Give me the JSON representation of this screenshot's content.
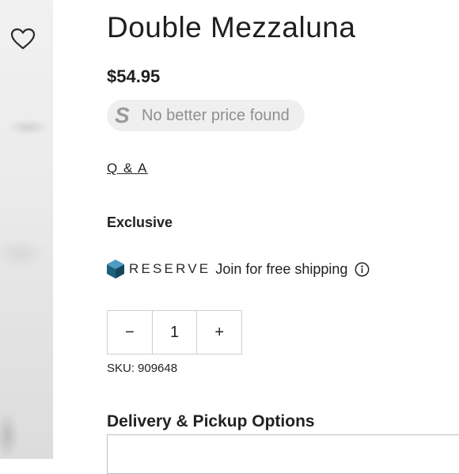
{
  "product": {
    "title": "Double Mezzaluna",
    "price": "$54.95"
  },
  "price_check": {
    "icon": "S",
    "text": "No better price found"
  },
  "links": {
    "qa": "Q & A"
  },
  "badge": {
    "exclusive": "Exclusive"
  },
  "reserve": {
    "brand": "RESERVE",
    "join_text": "Join for free shipping",
    "brand_color": "#1e5f7c"
  },
  "quantity": {
    "decrement": "−",
    "value": "1",
    "increment": "+"
  },
  "sku": {
    "label": "SKU:",
    "value": "909648"
  },
  "delivery": {
    "title": "Delivery & Pickup Options"
  }
}
